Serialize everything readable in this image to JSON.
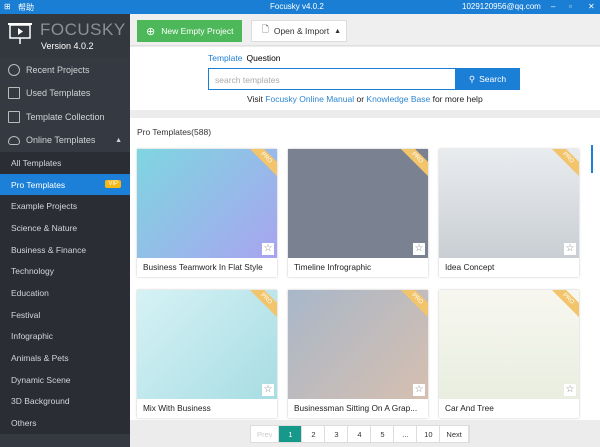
{
  "titlebar": {
    "menu": "帮助",
    "title": "Focusky v4.0.2",
    "account": "1029120956@qq.com"
  },
  "sidebar": {
    "logo": "FOCUSKY",
    "version": "Version 4.0.2",
    "items": [
      {
        "label": "Recent Projects",
        "icon": "clock-icon"
      },
      {
        "label": "Used Templates",
        "icon": "template-icon"
      },
      {
        "label": "Template Collection",
        "icon": "folder-icon"
      },
      {
        "label": "Online Templates",
        "icon": "cloud-icon"
      }
    ],
    "subitems": [
      "All Templates",
      "Pro Templates",
      "Example Projects",
      "Science & Nature",
      "Business & Finance",
      "Technology",
      "Education",
      "Festival",
      "Infographic",
      "Animals & Pets",
      "Dynamic Scene",
      "3D Background",
      "Others"
    ],
    "vip": "VIP"
  },
  "toolbar": {
    "new_project": "New Empty Project",
    "open_import": "Open & Import"
  },
  "search": {
    "tab_template": "Template",
    "tab_question": "Question",
    "placeholder": "search templates",
    "button": "Search",
    "help_visit": "Visit",
    "help_manual": "Focusky Online Manual",
    "help_or": "or",
    "help_kb": "Knowledge Base",
    "help_tail": "for more help"
  },
  "section": {
    "title": "Pro Templates(588)",
    "badge": "PRO"
  },
  "cards": [
    {
      "title": "Business Teamwork In Flat Style",
      "bg": "linear-gradient(135deg,#7fd6e0,#a8a4f0)"
    },
    {
      "title": "Timeline Infrographic",
      "bg": "#7a8191"
    },
    {
      "title": "Idea Concept",
      "bg": "linear-gradient(180deg,#e9ecef,#c9ced3)"
    },
    {
      "title": "Mix With Business",
      "bg": "linear-gradient(135deg,#d6f2f5,#a7dde3)"
    },
    {
      "title": "Businessman Sitting On A Grap...",
      "bg": "linear-gradient(135deg,#a8b7c9,#d6bfb0)"
    },
    {
      "title": "Car And Tree",
      "bg": "linear-gradient(180deg,#f7f7f0,#e9eee0)"
    }
  ],
  "pagination": {
    "prev": "Prev",
    "pages": [
      "1",
      "2",
      "3",
      "4",
      "5",
      "...",
      "10"
    ],
    "current": "1",
    "next": "Next"
  }
}
